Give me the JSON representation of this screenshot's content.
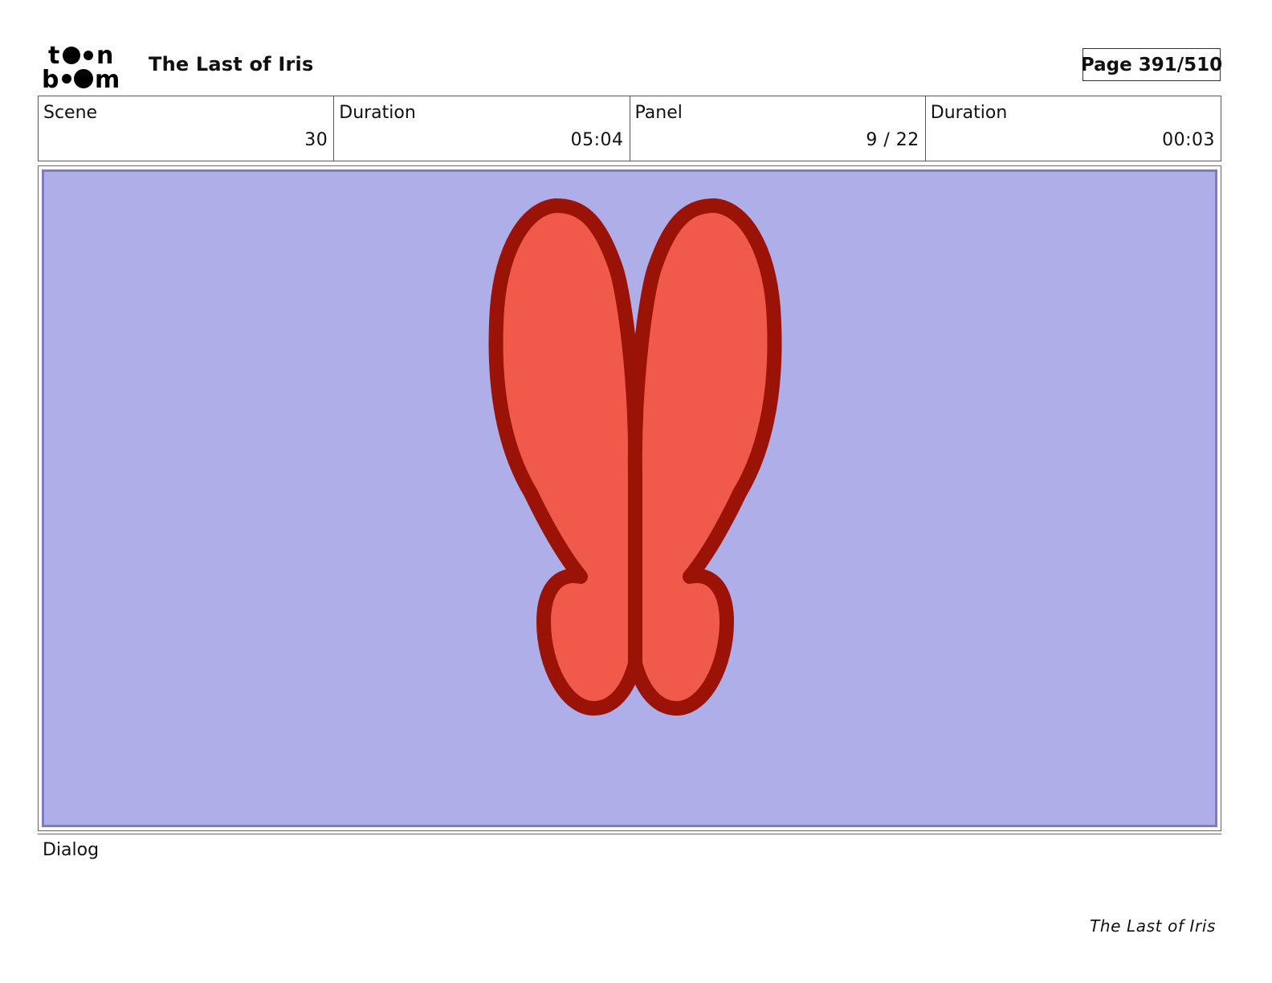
{
  "header": {
    "logo_text": "toon boom",
    "project_title": "The Last of Iris",
    "page_label": "Page 391/510"
  },
  "info": {
    "scene_label": "Scene",
    "scene_value": "30",
    "scene_duration_label": "Duration",
    "scene_duration_value": "05:04",
    "panel_label": "Panel",
    "panel_value": "9 / 22",
    "panel_duration_label": "Duration",
    "panel_duration_value": "00:03"
  },
  "panel": {
    "background_color": "#aeaee8",
    "fill_color": "#ef5a4b",
    "outline_color": "#9b1206"
  },
  "dialog": {
    "label": "Dialog"
  },
  "footer": {
    "title": "The Last of Iris"
  }
}
